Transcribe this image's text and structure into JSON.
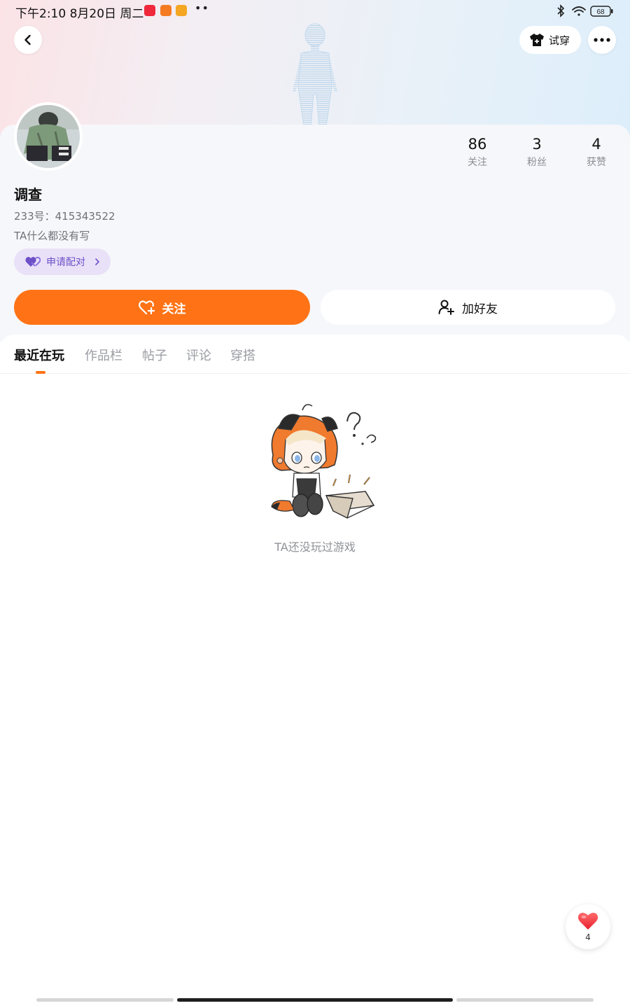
{
  "status_bar": {
    "time": "下午2:10 8月20日 周二",
    "more": "••",
    "battery": "68"
  },
  "header": {
    "back_icon": "chevron-left-icon",
    "tryon_label": "试穿",
    "tryon_icon": "shirt-icon",
    "more_icon": "ellipsis-icon"
  },
  "profile": {
    "name": "调查",
    "id_label": "233号：",
    "id_value": "415343522",
    "bio": "TA什么都没有写",
    "match_label": "申请配对",
    "stats": [
      {
        "value": "86",
        "label": "关注"
      },
      {
        "value": "3",
        "label": "粉丝"
      },
      {
        "value": "4",
        "label": "获赞"
      }
    ]
  },
  "actions": {
    "follow_label": "关注",
    "add_friend_label": "加好友"
  },
  "tabs": [
    {
      "label": "最近在玩",
      "active": true
    },
    {
      "label": "作品栏",
      "active": false
    },
    {
      "label": "帖子",
      "active": false
    },
    {
      "label": "评论",
      "active": false
    },
    {
      "label": "穿搭",
      "active": false
    }
  ],
  "empty_state": {
    "message": "TA还没玩过游戏"
  },
  "like_fab": {
    "count": "4"
  },
  "colors": {
    "accent": "#ff7316",
    "match_purple": "#6e50c8",
    "match_bg": "#e9e1f8"
  }
}
